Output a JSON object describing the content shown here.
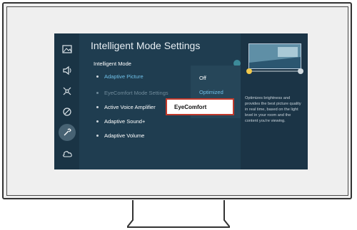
{
  "sidebar": {
    "icons": [
      "picture-icon",
      "sound-icon",
      "connection-icon",
      "broadcast-icon",
      "support-tools-icon",
      "cloud-icon"
    ]
  },
  "main": {
    "title": "Intelligent Mode Settings",
    "items": [
      {
        "label": "Intelligent Mode",
        "state": "normal"
      },
      {
        "label": "Adaptive Picture",
        "state": "highlight"
      },
      {
        "label": "EyeComfort Mode Settings",
        "state": "dim"
      },
      {
        "label": "Active Voice Amplifier",
        "state": "normal"
      },
      {
        "label": "Adaptive Sound+",
        "state": "normal"
      },
      {
        "label": "Adaptive Volume",
        "state": "normal"
      }
    ]
  },
  "dropdown": {
    "options": [
      "Off",
      "Optimized"
    ],
    "focused_option": "EyeComfort",
    "selected": "Optimized"
  },
  "help": {
    "description": "Optimizes brightness and provides the best picture quality in real time, based on the light level in your room and the content you're viewing."
  },
  "colors": {
    "screen_bg": "#1d3a4d",
    "accent": "#6fc0e8",
    "focus_border": "#c0392b"
  }
}
